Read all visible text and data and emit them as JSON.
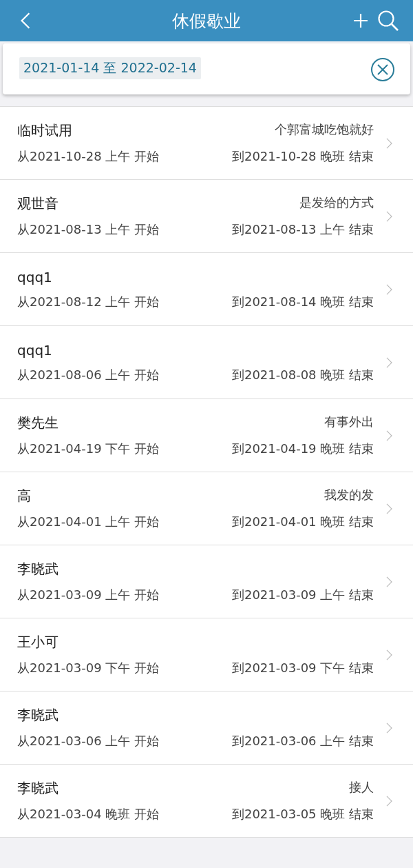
{
  "header": {
    "title": "休假歇业"
  },
  "filter": {
    "value": "2021-01-14 至 2022-02-14"
  },
  "records": [
    {
      "name": "临时试用",
      "note": "个郭富城吃饱就好",
      "start": "从2021-10-28 上午 开始",
      "end": "到2021-10-28 晚班 结束"
    },
    {
      "name": "观世音",
      "note": "是发给的方式",
      "start": "从2021-08-13 上午 开始",
      "end": "到2021-08-13 上午 结束"
    },
    {
      "name": "qqq1",
      "start": "从2021-08-12 上午 开始",
      "end": "到2021-08-14 晚班 结束"
    },
    {
      "name": "qqq1",
      "start": "从2021-08-06 上午 开始",
      "end": "到2021-08-08 晚班 结束"
    },
    {
      "name": "樊先生",
      "note": "有事外出",
      "start": "从2021-04-19 下午 开始",
      "end": "到2021-04-19 晚班 结束"
    },
    {
      "name": "高",
      "note": "我发的发",
      "start": "从2021-04-01 上午 开始",
      "end": "到2021-04-01 晚班 结束"
    },
    {
      "name": "李晓武",
      "start": "从2021-03-09 上午 开始",
      "end": "到2021-03-09 上午 结束"
    },
    {
      "name": "王小可",
      "start": "从2021-03-09 下午 开始",
      "end": "到2021-03-09 下午 结束"
    },
    {
      "name": "李晓武",
      "start": "从2021-03-06 上午 开始",
      "end": "到2021-03-06 上午 结束"
    },
    {
      "name": "李晓武",
      "note": "接人",
      "start": "从2021-03-04 晚班 开始",
      "end": "到2021-03-05 晚班 结束"
    }
  ]
}
